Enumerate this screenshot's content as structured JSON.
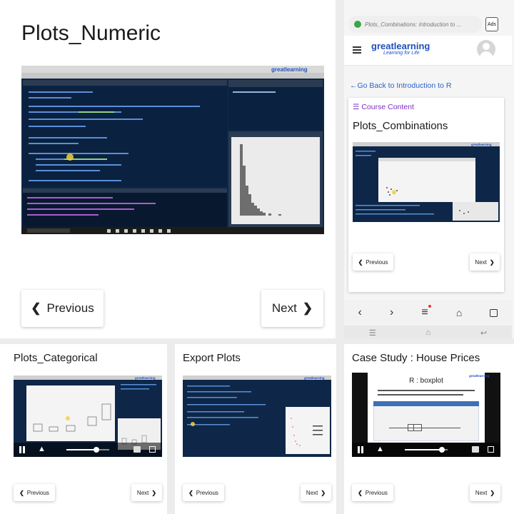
{
  "main_panel": {
    "title": "Plots_Numeric",
    "prev_label": "Previous",
    "next_label": "Next"
  },
  "phone_panel": {
    "url_text": "Plots_Combinations: Introduction to ...",
    "ads_label": "Ads",
    "logo_main": "greatlearning",
    "logo_sub": "Learning for Life",
    "back_link": "Go Back to Introduction to R",
    "course_content_label": "Course Content",
    "title": "Plots_Combinations",
    "prev_label": "Previous",
    "next_label": "Next"
  },
  "bottom_panels": [
    {
      "title": "Plots_Categorical",
      "prev_label": "Previous",
      "next_label": "Next"
    },
    {
      "title": "Export Plots",
      "prev_label": "Previous",
      "next_label": "Next"
    },
    {
      "title": "Case Study : House Prices",
      "prev_label": "Previous",
      "next_label": "Next",
      "slide_title": "R : boxplot"
    }
  ],
  "icons": {
    "prev": "chevron-left-icon",
    "next": "chevron-right-icon",
    "menu": "hamburger-icon",
    "avatar": "user-avatar-icon",
    "shield": "shield-check-icon"
  },
  "colors": {
    "video_bg": "#0c2442",
    "brand_blue": "#1f4fbf",
    "link_blue": "#2962c9",
    "course_purple": "#7a2fc4"
  }
}
